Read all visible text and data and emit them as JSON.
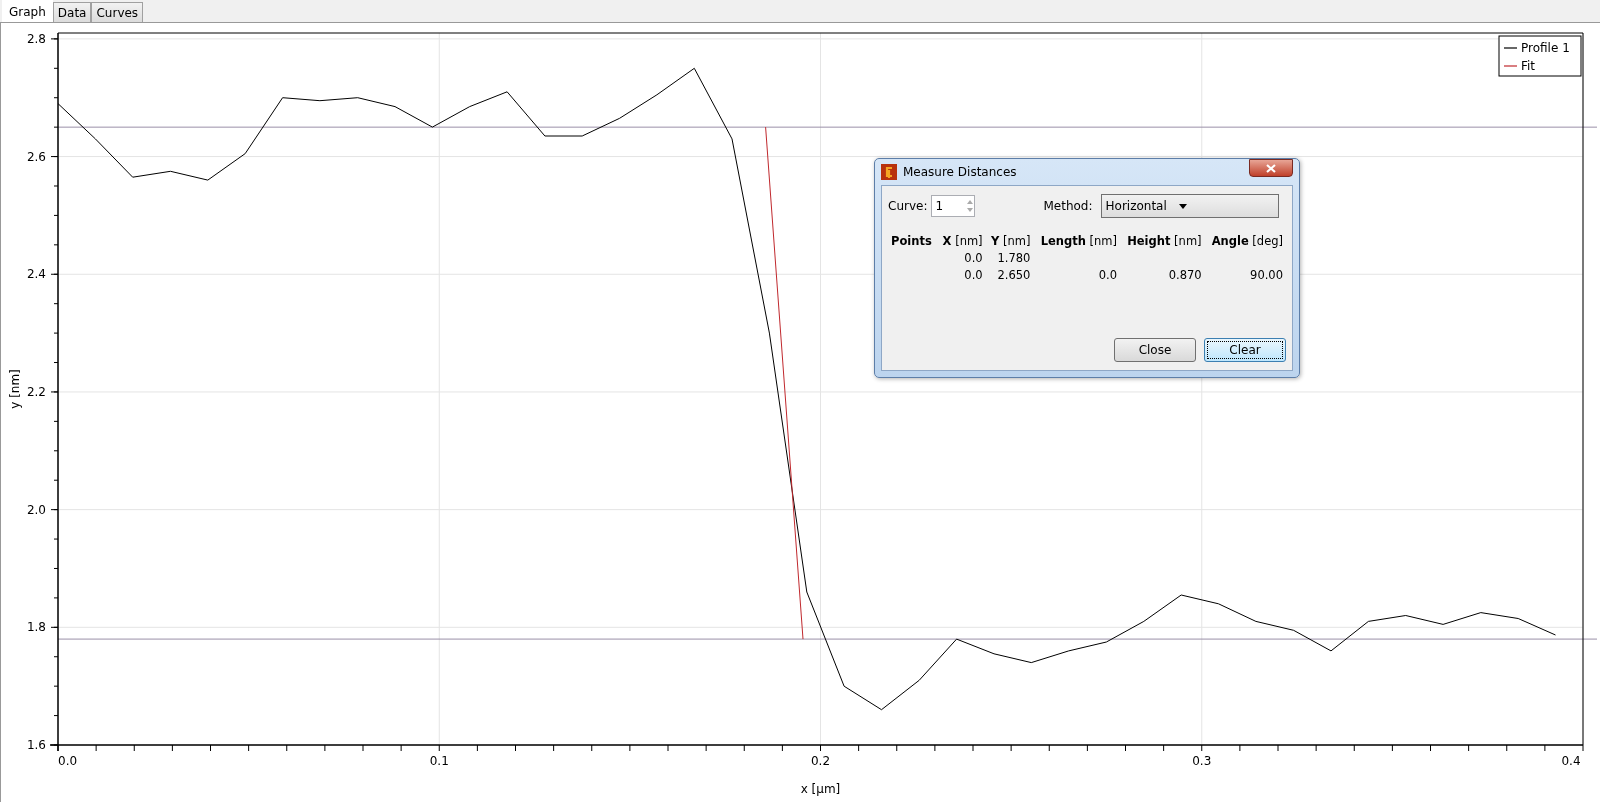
{
  "tabs": [
    {
      "label": "Graph",
      "selected": true
    },
    {
      "label": "Data",
      "selected": false
    },
    {
      "label": "Curves",
      "selected": false
    }
  ],
  "graph": {
    "chart_data": {
      "type": "line",
      "xlabel": "x [µm]",
      "ylabel": "y [nm]",
      "xlim": [
        0,
        0.4
      ],
      "ylim": [
        1.6,
        2.81
      ],
      "xticks": [
        {
          "value": 0,
          "label": "0.0"
        },
        0.1,
        0.2,
        0.3,
        0.4
      ],
      "yticks": [
        1.6,
        1.8,
        {
          "value": 2.0,
          "label": "2.0"
        },
        2.2,
        2.4,
        2.6,
        2.8
      ],
      "x": [
        0,
        0.0098,
        0.0196,
        0.0295,
        0.0393,
        0.0491,
        0.0589,
        0.0687,
        0.0786,
        0.0884,
        0.0982,
        0.108,
        0.1178,
        0.1277,
        0.1375,
        0.1473,
        0.1571,
        0.1669,
        0.1768,
        0.1866,
        0.1964,
        0.2062,
        0.216,
        0.2259,
        0.2357,
        0.2455,
        0.2553,
        0.2651,
        0.275,
        0.2848,
        0.2946,
        0.3044,
        0.3142,
        0.3241,
        0.3339,
        0.3437,
        0.3535,
        0.3633,
        0.3732,
        0.383,
        0.3928
      ],
      "series": [
        {
          "name": "Profile 1",
          "color": "#000000",
          "values": [
            2.69,
            2.63,
            2.565,
            2.575,
            2.56,
            2.605,
            2.7,
            2.695,
            2.7,
            2.685,
            2.65,
            2.685,
            2.71,
            2.635,
            2.635,
            2.665,
            2.705,
            2.75,
            2.63,
            2.3,
            1.86,
            1.7,
            1.66,
            1.71,
            1.78,
            1.755,
            1.74,
            1.76,
            1.775,
            1.81,
            1.855,
            1.84,
            1.81,
            1.795,
            1.76,
            1.81,
            1.82,
            1.805,
            1.825,
            1.815,
            1.787
          ]
        },
        {
          "name": "Fit",
          "color": "#c0282d",
          "x": [
            0.1856,
            0.1954
          ],
          "values": [
            2.65,
            1.78
          ]
        }
      ],
      "grid": true,
      "legend": true,
      "ref_lines": [
        {
          "axis": "y",
          "value": 2.65
        },
        {
          "axis": "y",
          "value": 1.78
        }
      ]
    }
  },
  "dialog": {
    "title": "Measure Distances",
    "curve_label": "Curve:",
    "curve_value": "1",
    "method_label": "Method:",
    "method_value": "Horizontal",
    "columns": [
      {
        "name": "Points"
      },
      {
        "name": "X",
        "unit": "[nm]"
      },
      {
        "name": "Y",
        "unit": "[nm]"
      },
      {
        "name": "Length",
        "unit": "[nm]"
      },
      {
        "name": "Height",
        "unit": "[nm]"
      },
      {
        "name": "Angle",
        "unit": "[deg]"
      }
    ],
    "rows": [
      [
        null,
        "0.0",
        "1.780",
        null,
        null,
        null
      ],
      [
        null,
        "0.0",
        "2.650",
        "0.0",
        "0.870",
        "90.00"
      ]
    ],
    "buttons": [
      {
        "label": "Close",
        "focused": false
      },
      {
        "label": "Clear",
        "focused": true
      }
    ]
  }
}
